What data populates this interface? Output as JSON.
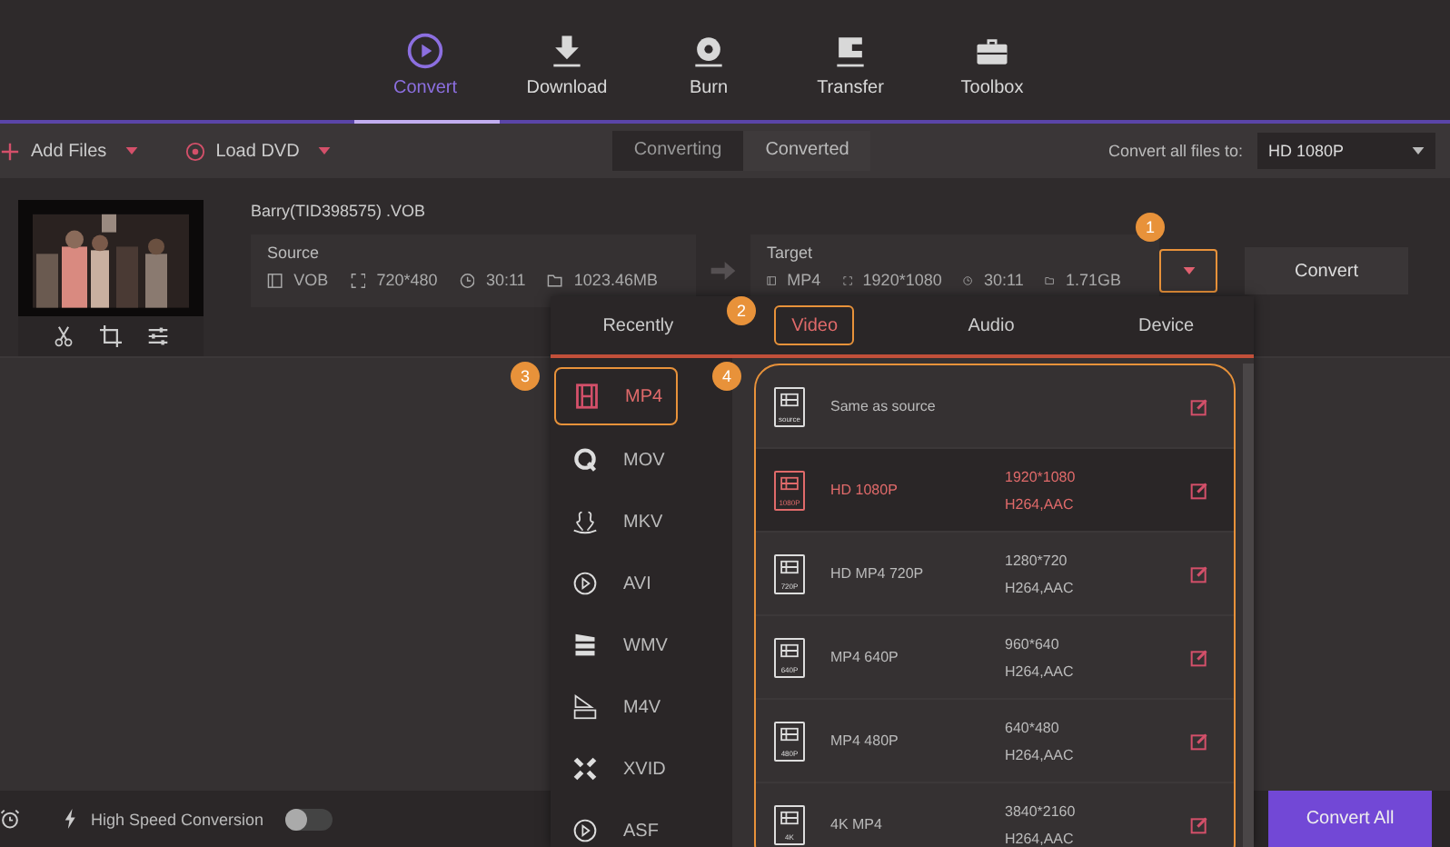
{
  "nav": [
    {
      "label": "Convert",
      "selected": true
    },
    {
      "label": "Download",
      "selected": false
    },
    {
      "label": "Burn",
      "selected": false
    },
    {
      "label": "Transfer",
      "selected": false
    },
    {
      "label": "Toolbox",
      "selected": false
    }
  ],
  "toolbar": {
    "add_files": "Add Files",
    "load_dvd": "Load DVD",
    "segments": [
      {
        "label": "Converting",
        "selected": true
      },
      {
        "label": "Converted",
        "selected": false
      }
    ],
    "convert_all_label": "Convert all files to:",
    "convert_all_value": "HD 1080P"
  },
  "file": {
    "name": "Barry(TID398575) .VOB",
    "source": {
      "label": "Source",
      "format": "VOB",
      "resolution": "720*480",
      "duration": "30:11",
      "size": "1023.46MB"
    },
    "target": {
      "label": "Target",
      "format": "MP4",
      "resolution": "1920*1080",
      "duration": "30:11",
      "size": "1.71GB"
    },
    "convert_button": "Convert"
  },
  "format_popup": {
    "tabs": [
      {
        "label": "Recently",
        "selected": false
      },
      {
        "label": "Video",
        "selected": true
      },
      {
        "label": "Audio",
        "selected": false
      },
      {
        "label": "Device",
        "selected": false
      }
    ],
    "categories": [
      {
        "label": "MP4",
        "selected": true
      },
      {
        "label": "MOV",
        "selected": false
      },
      {
        "label": "MKV",
        "selected": false
      },
      {
        "label": "AVI",
        "selected": false
      },
      {
        "label": "WMV",
        "selected": false
      },
      {
        "label": "M4V",
        "selected": false
      },
      {
        "label": "XVID",
        "selected": false
      },
      {
        "label": "ASF",
        "selected": false
      }
    ],
    "presets": [
      {
        "name": "Same as source",
        "icon_label": "source",
        "selected": false
      },
      {
        "name": "HD 1080P",
        "icon_label": "1080P",
        "resolution": "1920*1080",
        "codec": "H264,AAC",
        "selected": true
      },
      {
        "name": "HD MP4 720P",
        "icon_label": "720P",
        "resolution": "1280*720",
        "codec": "H264,AAC",
        "selected": false
      },
      {
        "name": "MP4 640P",
        "icon_label": "640P",
        "resolution": "960*640",
        "codec": "H264,AAC",
        "selected": false
      },
      {
        "name": "MP4 480P",
        "icon_label": "480P",
        "resolution": "640*480",
        "codec": "H264,AAC",
        "selected": false
      },
      {
        "name": "4K MP4",
        "icon_label": "4K",
        "resolution": "3840*2160",
        "codec": "H264,AAC",
        "selected": false
      }
    ]
  },
  "callouts": [
    "1",
    "2",
    "3",
    "4"
  ],
  "bottom": {
    "high_speed": "High Speed Conversion",
    "high_speed_on": false,
    "convert_all": "Convert All"
  }
}
